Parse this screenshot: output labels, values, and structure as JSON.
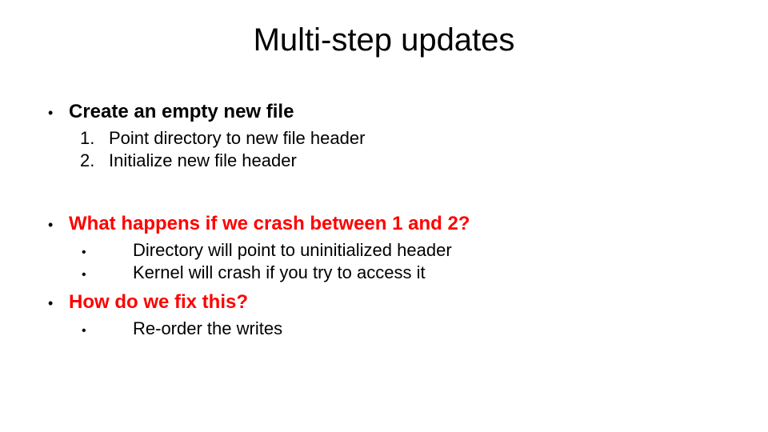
{
  "title": "Multi-step updates",
  "sections": [
    {
      "heading": "Create an empty new file",
      "red": false,
      "list_type": "numbered",
      "items": [
        "Point directory to new file header",
        "Initialize new file header"
      ]
    },
    {
      "heading": "What happens if we crash between 1 and 2?",
      "red": true,
      "list_type": "bulleted",
      "items": [
        "Directory will point to uninitialized header",
        "Kernel will crash if you try to access it"
      ]
    },
    {
      "heading": "How do we fix this?",
      "red": true,
      "list_type": "bulleted",
      "items": [
        "Re-order the writes"
      ]
    }
  ]
}
